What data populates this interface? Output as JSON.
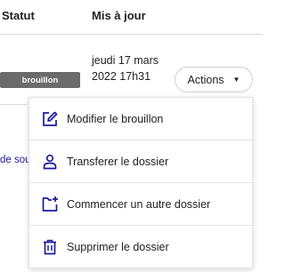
{
  "table": {
    "headers": {
      "statut": "Statut",
      "mis_a_jour": "Mis à jour"
    },
    "row": {
      "status_badge": "brouillon",
      "date_line1": "jeudi 17 mars",
      "date_line2": "2022 17h31",
      "actions_label": "Actions",
      "side_link_text": "de sou"
    }
  },
  "menu": {
    "items": [
      {
        "label": "Modifier le brouillon",
        "icon": "pencil-square-icon"
      },
      {
        "label": "Transferer le dossier",
        "icon": "person-icon"
      },
      {
        "label": "Commencer un autre dossier",
        "icon": "folder-plus-icon"
      },
      {
        "label": "Supprimer le dossier",
        "icon": "trash-icon"
      }
    ]
  },
  "colors": {
    "icon_blue": "#1a1a9c",
    "badge_gray": "#6b6b6b",
    "link_blue": "#1a1a9c"
  }
}
